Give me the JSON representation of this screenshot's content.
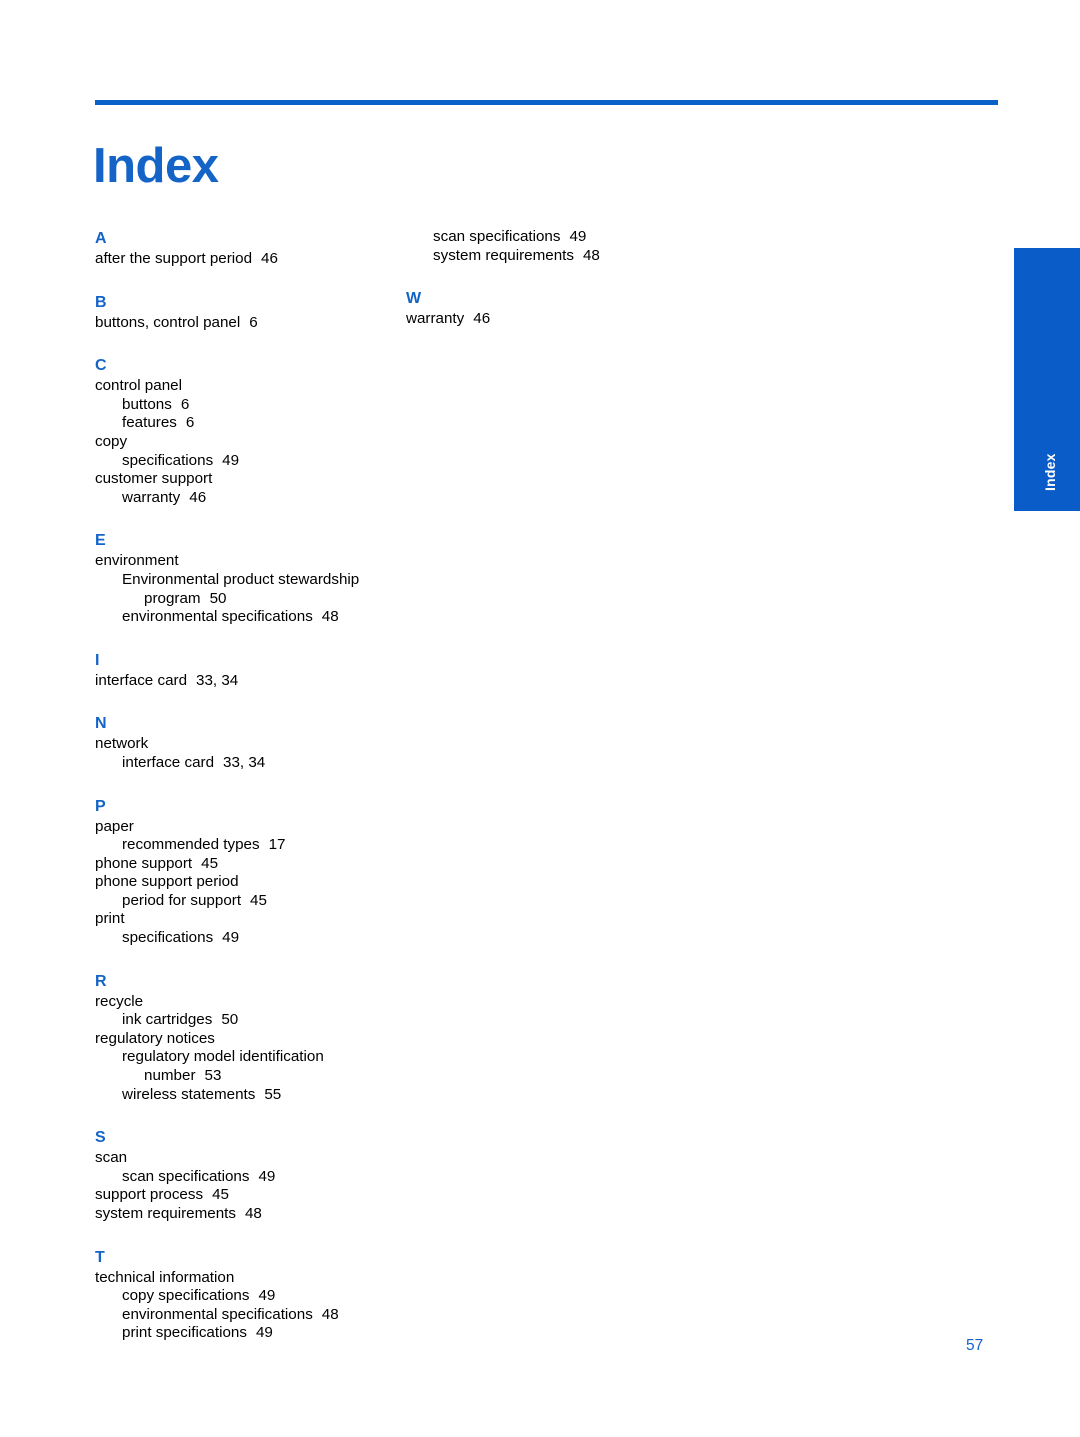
{
  "document": {
    "title": "Index",
    "page_number": "57",
    "accent_color": "#1464c8",
    "rule_color": "#0a62c8",
    "tab_color": "#0a5cc8",
    "tab_label": "Index"
  },
  "columns": {
    "left": {
      "sections": [
        {
          "letter": "A",
          "entries": [
            {
              "level": 1,
              "text": "after the support period",
              "pages": "46"
            }
          ]
        },
        {
          "letter": "B",
          "entries": [
            {
              "level": 1,
              "text": "buttons, control panel",
              "pages": "6"
            }
          ]
        },
        {
          "letter": "C",
          "entries": [
            {
              "level": 1,
              "text": "control panel",
              "pages": ""
            },
            {
              "level": 2,
              "text": "buttons",
              "pages": "6"
            },
            {
              "level": 2,
              "text": "features",
              "pages": "6"
            },
            {
              "level": 1,
              "text": "copy",
              "pages": ""
            },
            {
              "level": 2,
              "text": "specifications",
              "pages": "49"
            },
            {
              "level": 1,
              "text": "customer support",
              "pages": ""
            },
            {
              "level": 2,
              "text": "warranty",
              "pages": "46"
            }
          ]
        },
        {
          "letter": "E",
          "entries": [
            {
              "level": 1,
              "text": "environment",
              "pages": ""
            },
            {
              "level": 2,
              "text": "Environmental product stewardship",
              "pages": ""
            },
            {
              "level": 3,
              "text": "program",
              "pages": "50"
            },
            {
              "level": 2,
              "text": "environmental specifications",
              "pages": "48"
            }
          ]
        },
        {
          "letter": "I",
          "entries": [
            {
              "level": 1,
              "text": "interface card",
              "pages": "33, 34"
            }
          ]
        },
        {
          "letter": "N",
          "entries": [
            {
              "level": 1,
              "text": "network",
              "pages": ""
            },
            {
              "level": 2,
              "text": "interface card",
              "pages": "33, 34"
            }
          ]
        },
        {
          "letter": "P",
          "entries": [
            {
              "level": 1,
              "text": "paper",
              "pages": ""
            },
            {
              "level": 2,
              "text": "recommended types",
              "pages": "17"
            },
            {
              "level": 1,
              "text": "phone support",
              "pages": "45"
            },
            {
              "level": 1,
              "text": "phone support period",
              "pages": ""
            },
            {
              "level": 2,
              "text": "period for support",
              "pages": "45"
            },
            {
              "level": 1,
              "text": "print",
              "pages": ""
            },
            {
              "level": 2,
              "text": "specifications",
              "pages": "49"
            }
          ]
        },
        {
          "letter": "R",
          "entries": [
            {
              "level": 1,
              "text": "recycle",
              "pages": ""
            },
            {
              "level": 2,
              "text": "ink cartridges",
              "pages": "50"
            },
            {
              "level": 1,
              "text": "regulatory notices",
              "pages": ""
            },
            {
              "level": 2,
              "text": "regulatory model identification",
              "pages": ""
            },
            {
              "level": 3,
              "text": "number",
              "pages": "53"
            },
            {
              "level": 2,
              "text": "wireless statements",
              "pages": "55"
            }
          ]
        },
        {
          "letter": "S",
          "entries": [
            {
              "level": 1,
              "text": "scan",
              "pages": ""
            },
            {
              "level": 2,
              "text": "scan specifications",
              "pages": "49"
            },
            {
              "level": 1,
              "text": "support process",
              "pages": "45"
            },
            {
              "level": 1,
              "text": "system requirements",
              "pages": "48"
            }
          ]
        },
        {
          "letter": "T",
          "entries": [
            {
              "level": 1,
              "text": "technical information",
              "pages": ""
            },
            {
              "level": 2,
              "text": "copy specifications",
              "pages": "49"
            },
            {
              "level": 2,
              "text": "environmental specifications",
              "pages": "48"
            },
            {
              "level": 2,
              "text": "print specifications",
              "pages": "49"
            }
          ]
        }
      ]
    },
    "right": {
      "continued_entries": [
        {
          "level": 2,
          "text": "scan specifications",
          "pages": "49"
        },
        {
          "level": 2,
          "text": "system requirements",
          "pages": "48"
        }
      ],
      "sections": [
        {
          "letter": "W",
          "entries": [
            {
              "level": 1,
              "text": "warranty",
              "pages": "46"
            }
          ]
        }
      ]
    }
  }
}
